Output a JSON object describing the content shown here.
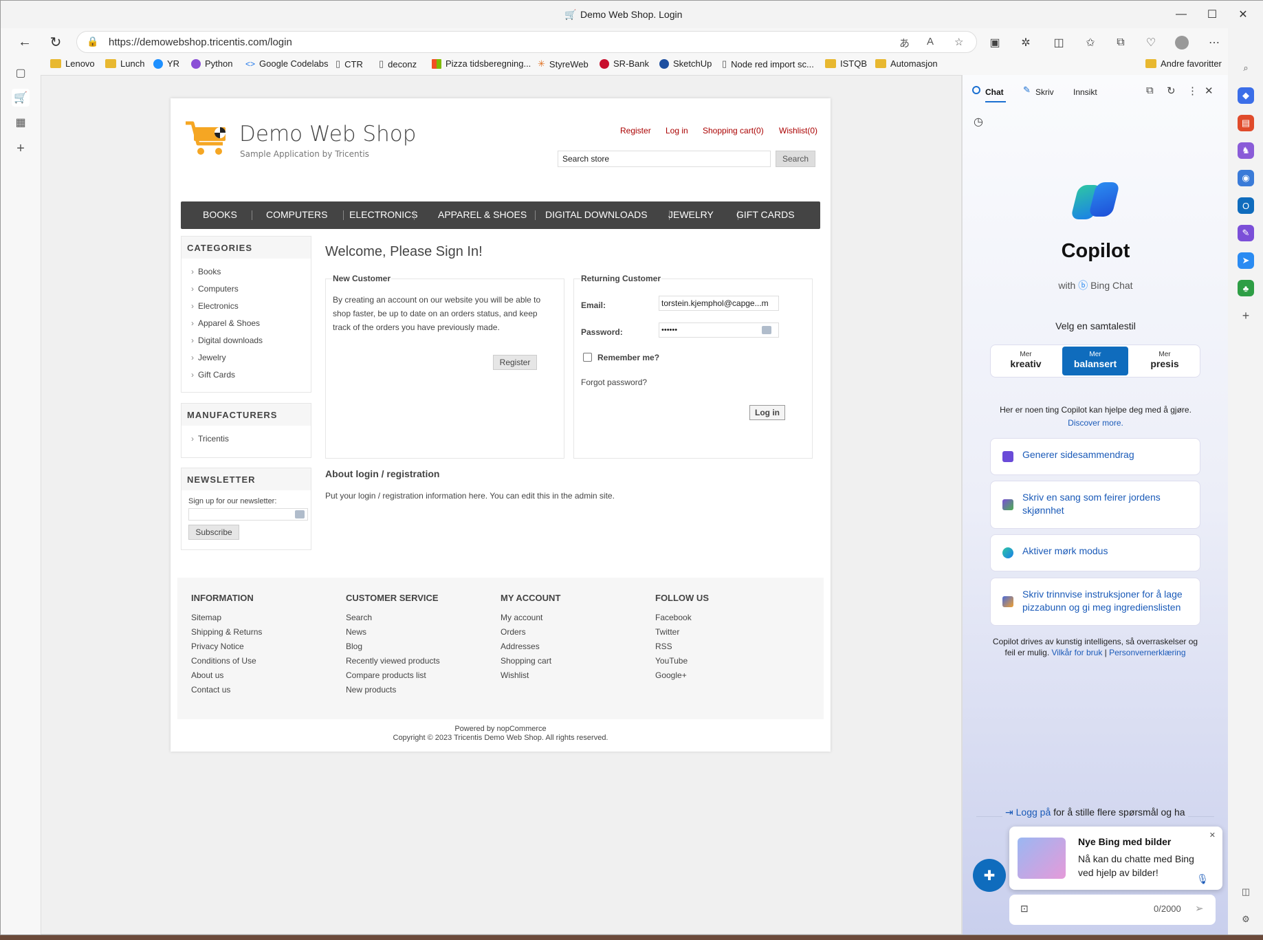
{
  "window": {
    "title": "Demo Web Shop. Login"
  },
  "browser": {
    "url": "https://demowebshop.tricentis.com/login",
    "bookmarks": [
      "Lenovo",
      "Lunch",
      "YR",
      "Python",
      "Google Codelabs",
      "CTR",
      "deconz",
      "Pizza tidsberegning...",
      "StyreWeb",
      "SR-Bank",
      "SketchUp",
      "Node red import sc...",
      "ISTQB",
      "Automasjon"
    ],
    "other_favorites": "Andre favoritter"
  },
  "shop": {
    "title": "Demo Web Shop",
    "subtitle": "Sample Application by Tricentis",
    "header_links": {
      "register": "Register",
      "login": "Log in",
      "cart": "Shopping cart(0)",
      "wishlist": "Wishlist(0)"
    },
    "search": {
      "value": "Search store",
      "button": "Search"
    },
    "menu": [
      "BOOKS",
      "COMPUTERS",
      "ELECTRONICS",
      "APPAREL & SHOES",
      "DIGITAL DOWNLOADS",
      "JEWELRY",
      "GIFT CARDS"
    ],
    "categories": {
      "title": "CATEGORIES",
      "items": [
        "Books",
        "Computers",
        "Electronics",
        "Apparel & Shoes",
        "Digital downloads",
        "Jewelry",
        "Gift Cards"
      ]
    },
    "manufacturers": {
      "title": "MANUFACTURERS",
      "items": [
        "Tricentis"
      ]
    },
    "newsletter": {
      "title": "NEWSLETTER",
      "label": "Sign up for our newsletter:",
      "button": "Subscribe"
    },
    "welcome": "Welcome, Please Sign In!",
    "new_customer": {
      "title": "New Customer",
      "text": "By creating an account on our website you will be able to shop faster, be up to date on an orders status, and keep track of the orders you have previously made.",
      "button": "Register"
    },
    "returning": {
      "title": "Returning Customer",
      "email_label": "Email:",
      "email_value": "torstein.kjemphol@capge...m",
      "password_label": "Password:",
      "password_value": "••••••",
      "remember": "Remember me?",
      "forgot": "Forgot password?",
      "button": "Log in"
    },
    "about": {
      "title": "About login / registration",
      "text": "Put your login / registration information here. You can edit this in the admin site."
    },
    "footer": {
      "information": {
        "title": "INFORMATION",
        "links": [
          "Sitemap",
          "Shipping & Returns",
          "Privacy Notice",
          "Conditions of Use",
          "About us",
          "Contact us"
        ]
      },
      "customer_service": {
        "title": "CUSTOMER SERVICE",
        "links": [
          "Search",
          "News",
          "Blog",
          "Recently viewed products",
          "Compare products list",
          "New products"
        ]
      },
      "my_account": {
        "title": "MY ACCOUNT",
        "links": [
          "My account",
          "Orders",
          "Addresses",
          "Shopping cart",
          "Wishlist"
        ]
      },
      "follow_us": {
        "title": "FOLLOW US",
        "links": [
          "Facebook",
          "Twitter",
          "RSS",
          "YouTube",
          "Google+"
        ]
      },
      "powered": "Powered by nopCommerce",
      "copyright": "Copyright © 2023 Tricentis Demo Web Shop. All rights reserved."
    }
  },
  "copilot": {
    "tabs": [
      "Chat",
      "Skriv",
      "Innsikt"
    ],
    "name": "Copilot",
    "with": "with",
    "bing_chat": "Bing Chat",
    "style_heading": "Velg en samtalestil",
    "styles": [
      {
        "top": "Mer",
        "main": "kreativ"
      },
      {
        "top": "Mer",
        "main": "balansert"
      },
      {
        "top": "Mer",
        "main": "presis"
      }
    ],
    "help_text": "Her er noen ting Copilot kan hjelpe deg med å gjøre.",
    "discover": "Discover more.",
    "suggestions": [
      "Generer sidesammendrag",
      "Skriv en sang som feirer jordens skjønnhet",
      "Aktiver mørk modus",
      "Skriv trinnvise instruksjoner for å lage pizzabunn og gi meg ingredienslisten"
    ],
    "disclaimer": "Copilot drives av kunstig intelligens, så overraskelser og feil er mulig.",
    "terms": "Vilkår for bruk",
    "privacy": "Personvernerklæring",
    "login_link": "Logg på",
    "login_rest": "for å stille flere spørsmål og ha",
    "toast_title": "Nye Bing med bilder",
    "toast_text": "Nå kan du chatte med Bing ved hjelp av bilder!",
    "counter": "0/2000"
  },
  "colors": {
    "accent": "#0f6cbd",
    "link": "#a00",
    "menu": "#444",
    "brand_cart": "#f5a623"
  }
}
